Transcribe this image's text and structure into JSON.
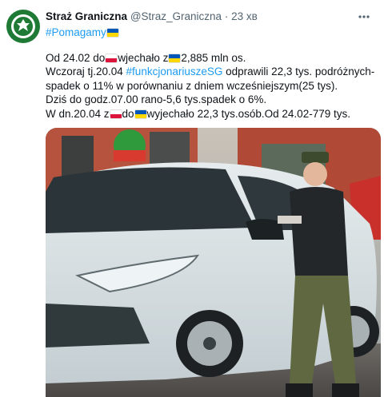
{
  "tweet": {
    "author_name": "Straż Graniczna",
    "handle": "@Straz_Graniczna",
    "separator": "·",
    "time": "23 хв",
    "hashtag": "#Pomagamy",
    "line1": {
      "a": "Od 24.02 do",
      "b": "wjechało z",
      "c": "2,885 mln os."
    },
    "line2": {
      "a": "Wczoraj tj.20.04 ",
      "tag": "#funkcjonariuszeSG",
      "b": " odprawili 22,3 tys. podróżnych-"
    },
    "line3": "spadek o 11% w porównaniu z dniem wcześniejszym(25 tys).",
    "line4": "Dziś do godz.07.00 rano-5,6 tys.spadek o 6%.",
    "line5": {
      "a": "W dn.20.04 z",
      "b": "do",
      "c": "wyjechało 22,3 tys.osób.Od 24.02-779 tys."
    },
    "more_icon": "more-horizontal-icon"
  },
  "colors": {
    "link": "#1d9bf0",
    "muted": "#536471",
    "avatar_bg": "#1f7a35",
    "flag_pl": [
      "#ffffff",
      "#dc143c"
    ],
    "flag_ua": [
      "#0057b7",
      "#ffd700"
    ]
  }
}
